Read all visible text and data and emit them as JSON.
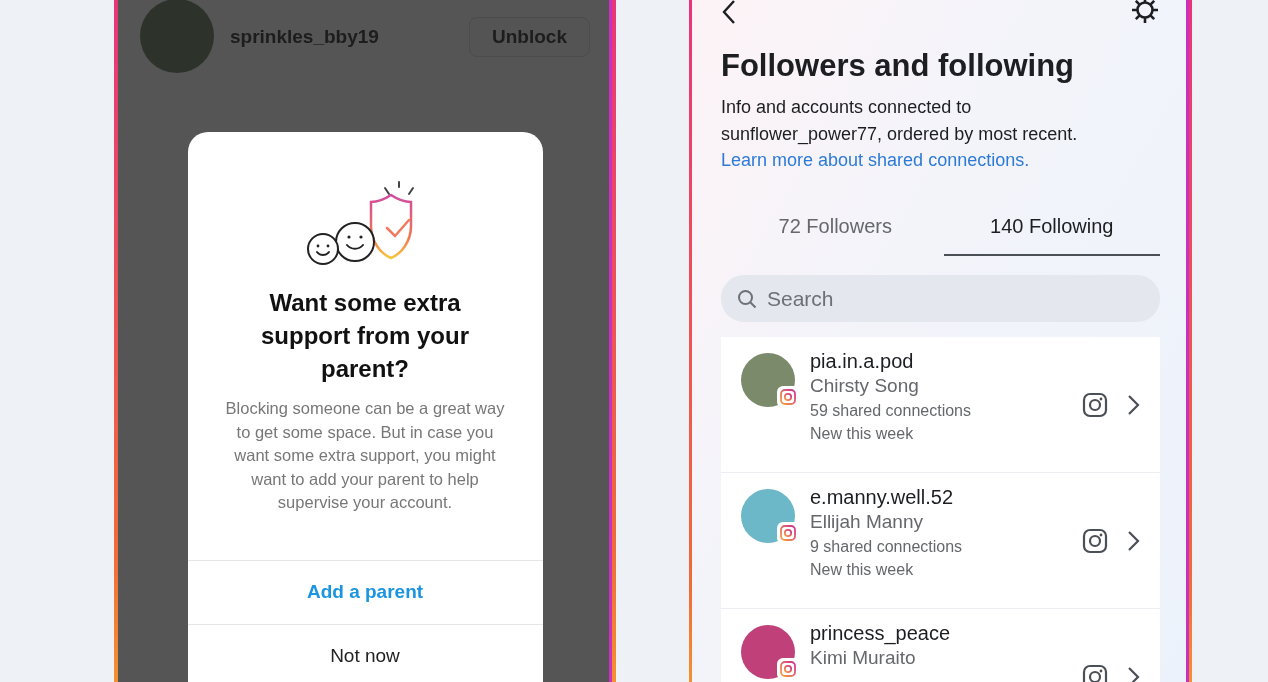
{
  "blocked_screen": {
    "user": {
      "username": "sprinkles_bby19",
      "action": "Unblock"
    },
    "dialog": {
      "title": "Want some extra support from your parent?",
      "message": "Blocking someone can be a great way to get some space. But in case you want some extra support, you might want to add your parent to help supervise your account.",
      "actions": [
        {
          "label": "Add a parent",
          "kind": "primary"
        },
        {
          "label": "Not now",
          "kind": "secondary"
        }
      ]
    }
  },
  "connections_screen": {
    "title": "Followers and following",
    "description": "Info and accounts connected to sunflower_power77, ordered by most recent.",
    "link": "Learn more about shared connections.",
    "tabs": [
      {
        "label": "72 Followers",
        "selected": false
      },
      {
        "label": "140 Following",
        "selected": true
      }
    ],
    "search": {
      "placeholder": "Search"
    },
    "accounts": [
      {
        "username": "pia.in.a.pod",
        "name": "Chirsty Song",
        "shared": "59 shared connections",
        "note": "New this week"
      },
      {
        "username": "e.manny.well.52",
        "name": "Ellijah Manny",
        "shared": "9 shared connections",
        "note": "New this week"
      },
      {
        "username": "princess_peace",
        "name": "Kimi Muraito"
      }
    ]
  }
}
